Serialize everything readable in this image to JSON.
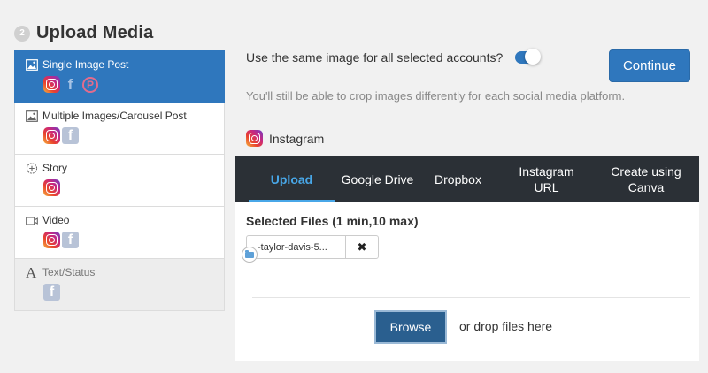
{
  "step": {
    "number": "2",
    "title": "Upload Media"
  },
  "post_types": [
    {
      "label": "Single Image Post",
      "icon": "image-icon",
      "socials": [
        "instagram",
        "facebook",
        "pinterest"
      ],
      "state": "active"
    },
    {
      "label": "Multiple Images/Carousel Post",
      "icon": "images-icon",
      "socials": [
        "instagram",
        "facebook"
      ],
      "state": "normal"
    },
    {
      "label": "Story",
      "icon": "story-plus-icon",
      "socials": [
        "instagram"
      ],
      "state": "normal"
    },
    {
      "label": "Video",
      "icon": "video-camera-icon",
      "socials": [
        "instagram",
        "facebook"
      ],
      "state": "normal"
    },
    {
      "label": "Text/Status",
      "icon": "text-a-icon",
      "socials": [
        "facebook"
      ],
      "state": "disabled"
    }
  ],
  "main": {
    "same_image_label": "Use the same image for all selected accounts?",
    "toggle_on": true,
    "continue_label": "Continue",
    "crop_note": "You'll still be able to crop images differently for each social media platform.",
    "network_name": "Instagram"
  },
  "upload": {
    "tabs": [
      {
        "label": "Upload",
        "active": true
      },
      {
        "label": "Google Drive",
        "active": false
      },
      {
        "label": "Dropbox",
        "active": false
      },
      {
        "label": "Instagram URL",
        "active": false
      },
      {
        "label": "Create using Canva",
        "active": false
      }
    ],
    "selected_files_label": "Selected Files (1 min,10 max)",
    "file_name": "-taylor-davis-5...",
    "remove_glyph": "✖",
    "browse_label": "Browse",
    "drop_text": "or drop files here"
  },
  "colors": {
    "accent": "#2f77bd",
    "tab_bar": "#2b3036",
    "tab_active": "#48a7e8"
  }
}
